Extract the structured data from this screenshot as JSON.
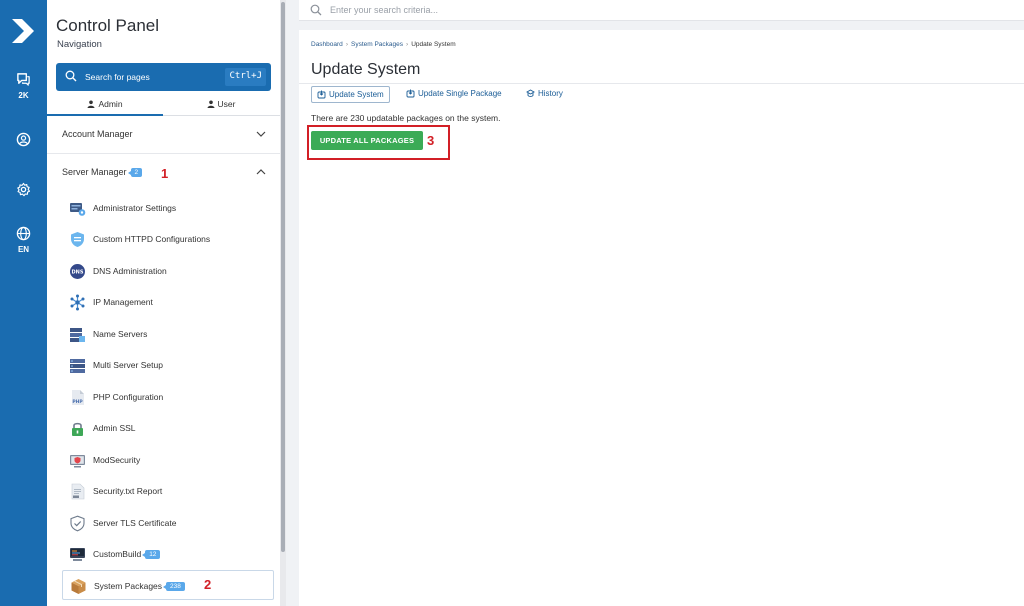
{
  "rail": {
    "chat_count": "2K",
    "language": "EN"
  },
  "nav": {
    "title": "Control Panel",
    "subtitle": "Navigation",
    "search_label": "Search for pages",
    "search_shortcut": "Ctrl+J",
    "tabs": [
      {
        "label": "Admin",
        "active": true
      },
      {
        "label": "User",
        "active": false
      }
    ],
    "account_manager": "Account Manager",
    "server_manager": "Server Manager",
    "server_manager_badge": "2",
    "items": [
      {
        "label": "Administrator Settings",
        "icon": "admin-settings-icon"
      },
      {
        "label": "Custom HTTPD Configurations",
        "icon": "shield-config-icon"
      },
      {
        "label": "DNS Administration",
        "icon": "dns-icon"
      },
      {
        "label": "IP Management",
        "icon": "network-icon"
      },
      {
        "label": "Name Servers",
        "icon": "name-servers-icon"
      },
      {
        "label": "Multi Server Setup",
        "icon": "multi-server-icon"
      },
      {
        "label": "PHP Configuration",
        "icon": "php-icon"
      },
      {
        "label": "Admin SSL",
        "icon": "lock-icon"
      },
      {
        "label": "ModSecurity",
        "icon": "mod-security-icon"
      },
      {
        "label": "Security.txt Report",
        "icon": "document-icon"
      },
      {
        "label": "Server TLS Certificate",
        "icon": "shield-check-icon"
      },
      {
        "label": "CustomBuild",
        "icon": "custombuild-icon",
        "badge": "12"
      },
      {
        "label": "System Packages",
        "icon": "package-icon",
        "badge": "238",
        "selected": true
      }
    ]
  },
  "annotations": [
    "1",
    "2",
    "3"
  ],
  "topsearch": {
    "placeholder": "Enter your search criteria..."
  },
  "main": {
    "breadcrumbs": [
      "Dashboard",
      "System Packages",
      "Update System"
    ],
    "title": "Update System",
    "tabs": [
      {
        "label": "Update System",
        "active": true
      },
      {
        "label": "Update Single Package",
        "active": false
      },
      {
        "label": "History",
        "active": false
      }
    ],
    "info": "There are 230 updatable packages on the system.",
    "update_button": "UPDATE ALL PACKAGES"
  },
  "colors": {
    "brand_blue": "#1a6cb0",
    "badge_blue": "#5aa8ea",
    "success_green": "#3bab56",
    "annotation_red": "#d21f26"
  }
}
